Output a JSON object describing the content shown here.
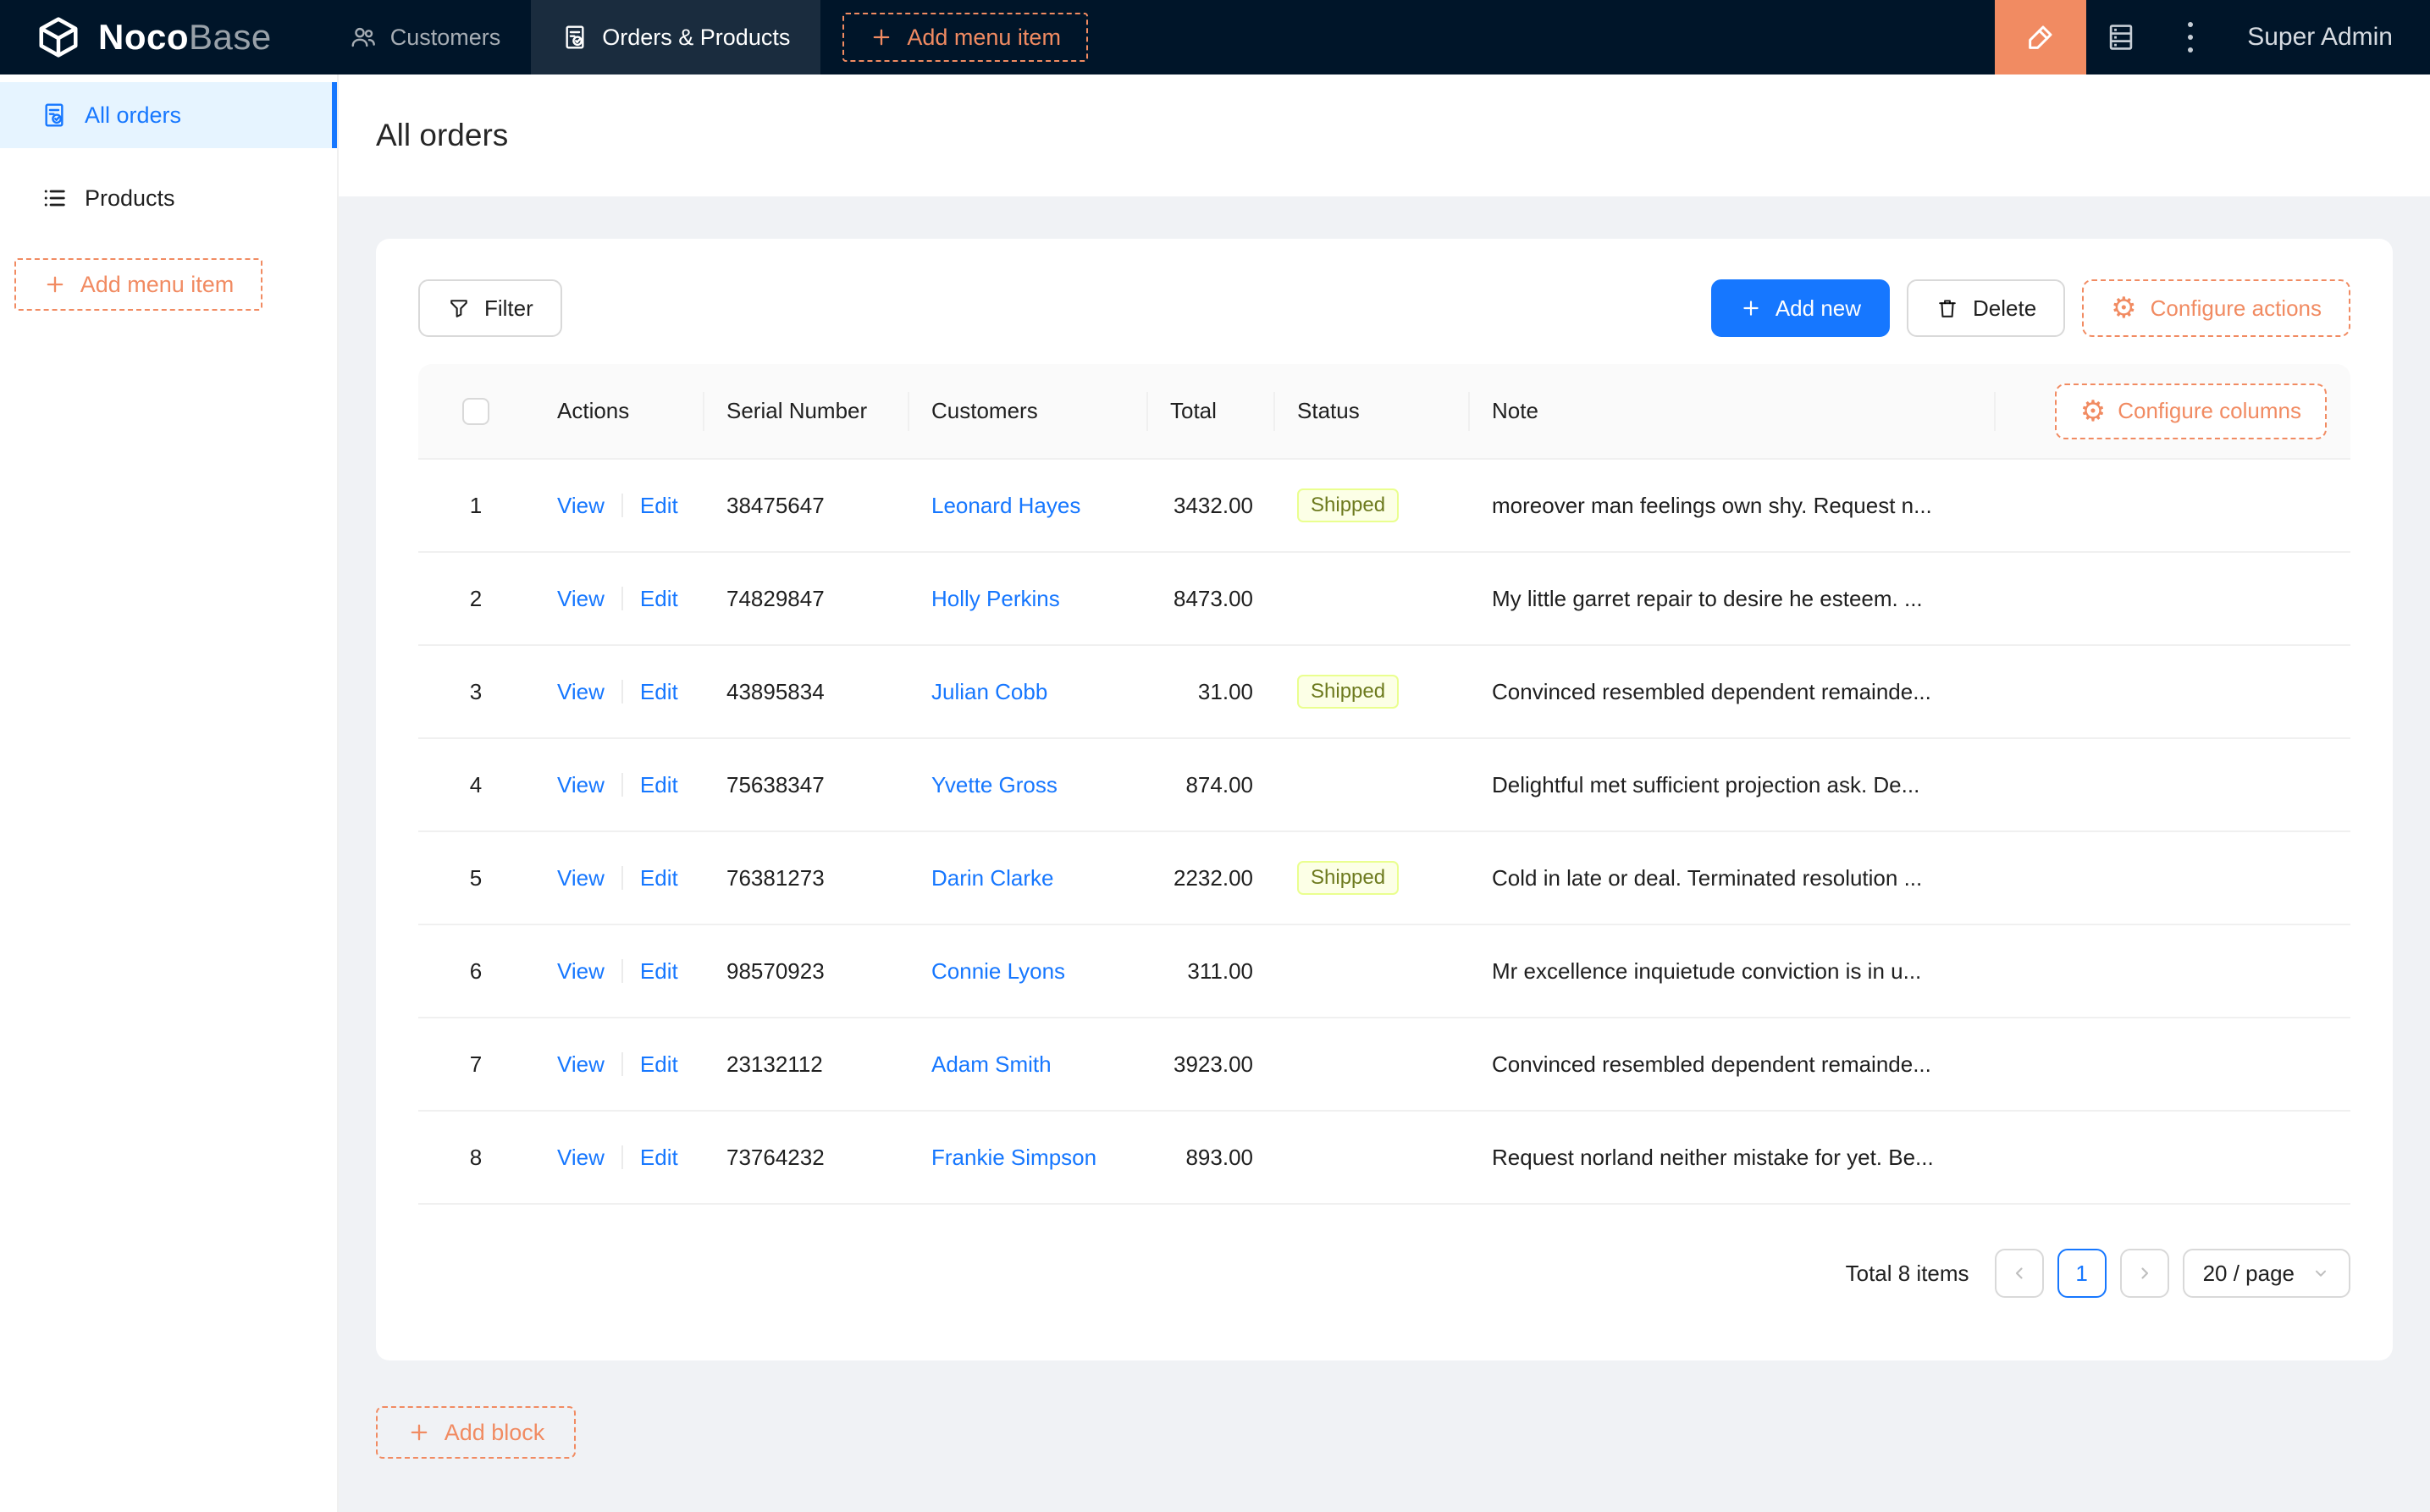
{
  "colors": {
    "accent_orange": "#F18B62",
    "primary_blue": "#1677FF",
    "header_bg": "#001529",
    "status_lime_bg": "#FCFFE6"
  },
  "header": {
    "logo_bold": "Noco",
    "logo_light": "Base",
    "nav": [
      {
        "label": "Customers"
      },
      {
        "label": "Orders & Products"
      }
    ],
    "add_menu_item": "Add menu item",
    "user": "Super Admin"
  },
  "sidebar": {
    "items": [
      {
        "label": "All orders"
      },
      {
        "label": "Products"
      }
    ],
    "add_menu_item": "Add menu item"
  },
  "page": {
    "title": "All orders"
  },
  "toolbar": {
    "filter": "Filter",
    "add_new": "Add new",
    "delete": "Delete",
    "configure_actions": "Configure actions"
  },
  "table": {
    "columns": [
      "Actions",
      "Serial Number",
      "Customers",
      "Total",
      "Status",
      "Note"
    ],
    "configure_columns": "Configure columns",
    "actions": {
      "view": "View",
      "edit": "Edit"
    },
    "rows": [
      {
        "index": "1",
        "serial": "38475647",
        "customer": "Leonard Hayes",
        "total": "3432.00",
        "status": "Shipped",
        "note": "moreover man feelings own shy. Request n..."
      },
      {
        "index": "2",
        "serial": "74829847",
        "customer": "Holly Perkins",
        "total": "8473.00",
        "status": "",
        "note": "My little garret repair to desire he esteem. ..."
      },
      {
        "index": "3",
        "serial": "43895834",
        "customer": "Julian Cobb",
        "total": "31.00",
        "status": "Shipped",
        "note": "Convinced resembled dependent remainde..."
      },
      {
        "index": "4",
        "serial": "75638347",
        "customer": "Yvette Gross",
        "total": "874.00",
        "status": "",
        "note": "Delightful met sufficient projection ask. De..."
      },
      {
        "index": "5",
        "serial": "76381273",
        "customer": "Darin Clarke",
        "total": "2232.00",
        "status": "Shipped",
        "note": "Cold in late or deal. Terminated resolution ..."
      },
      {
        "index": "6",
        "serial": "98570923",
        "customer": "Connie Lyons",
        "total": "311.00",
        "status": "",
        "note": "Mr excellence inquietude conviction is in u..."
      },
      {
        "index": "7",
        "serial": "23132112",
        "customer": "Adam Smith",
        "total": "3923.00",
        "status": "",
        "note": "Convinced resembled dependent remainde..."
      },
      {
        "index": "8",
        "serial": "73764232",
        "customer": "Frankie Simpson",
        "total": "893.00",
        "status": "",
        "note": "Request norland neither mistake for yet. Be..."
      }
    ]
  },
  "pagination": {
    "total": "Total 8 items",
    "current": "1",
    "page_size": "20 / page"
  },
  "footer": {
    "add_block": "Add block"
  }
}
